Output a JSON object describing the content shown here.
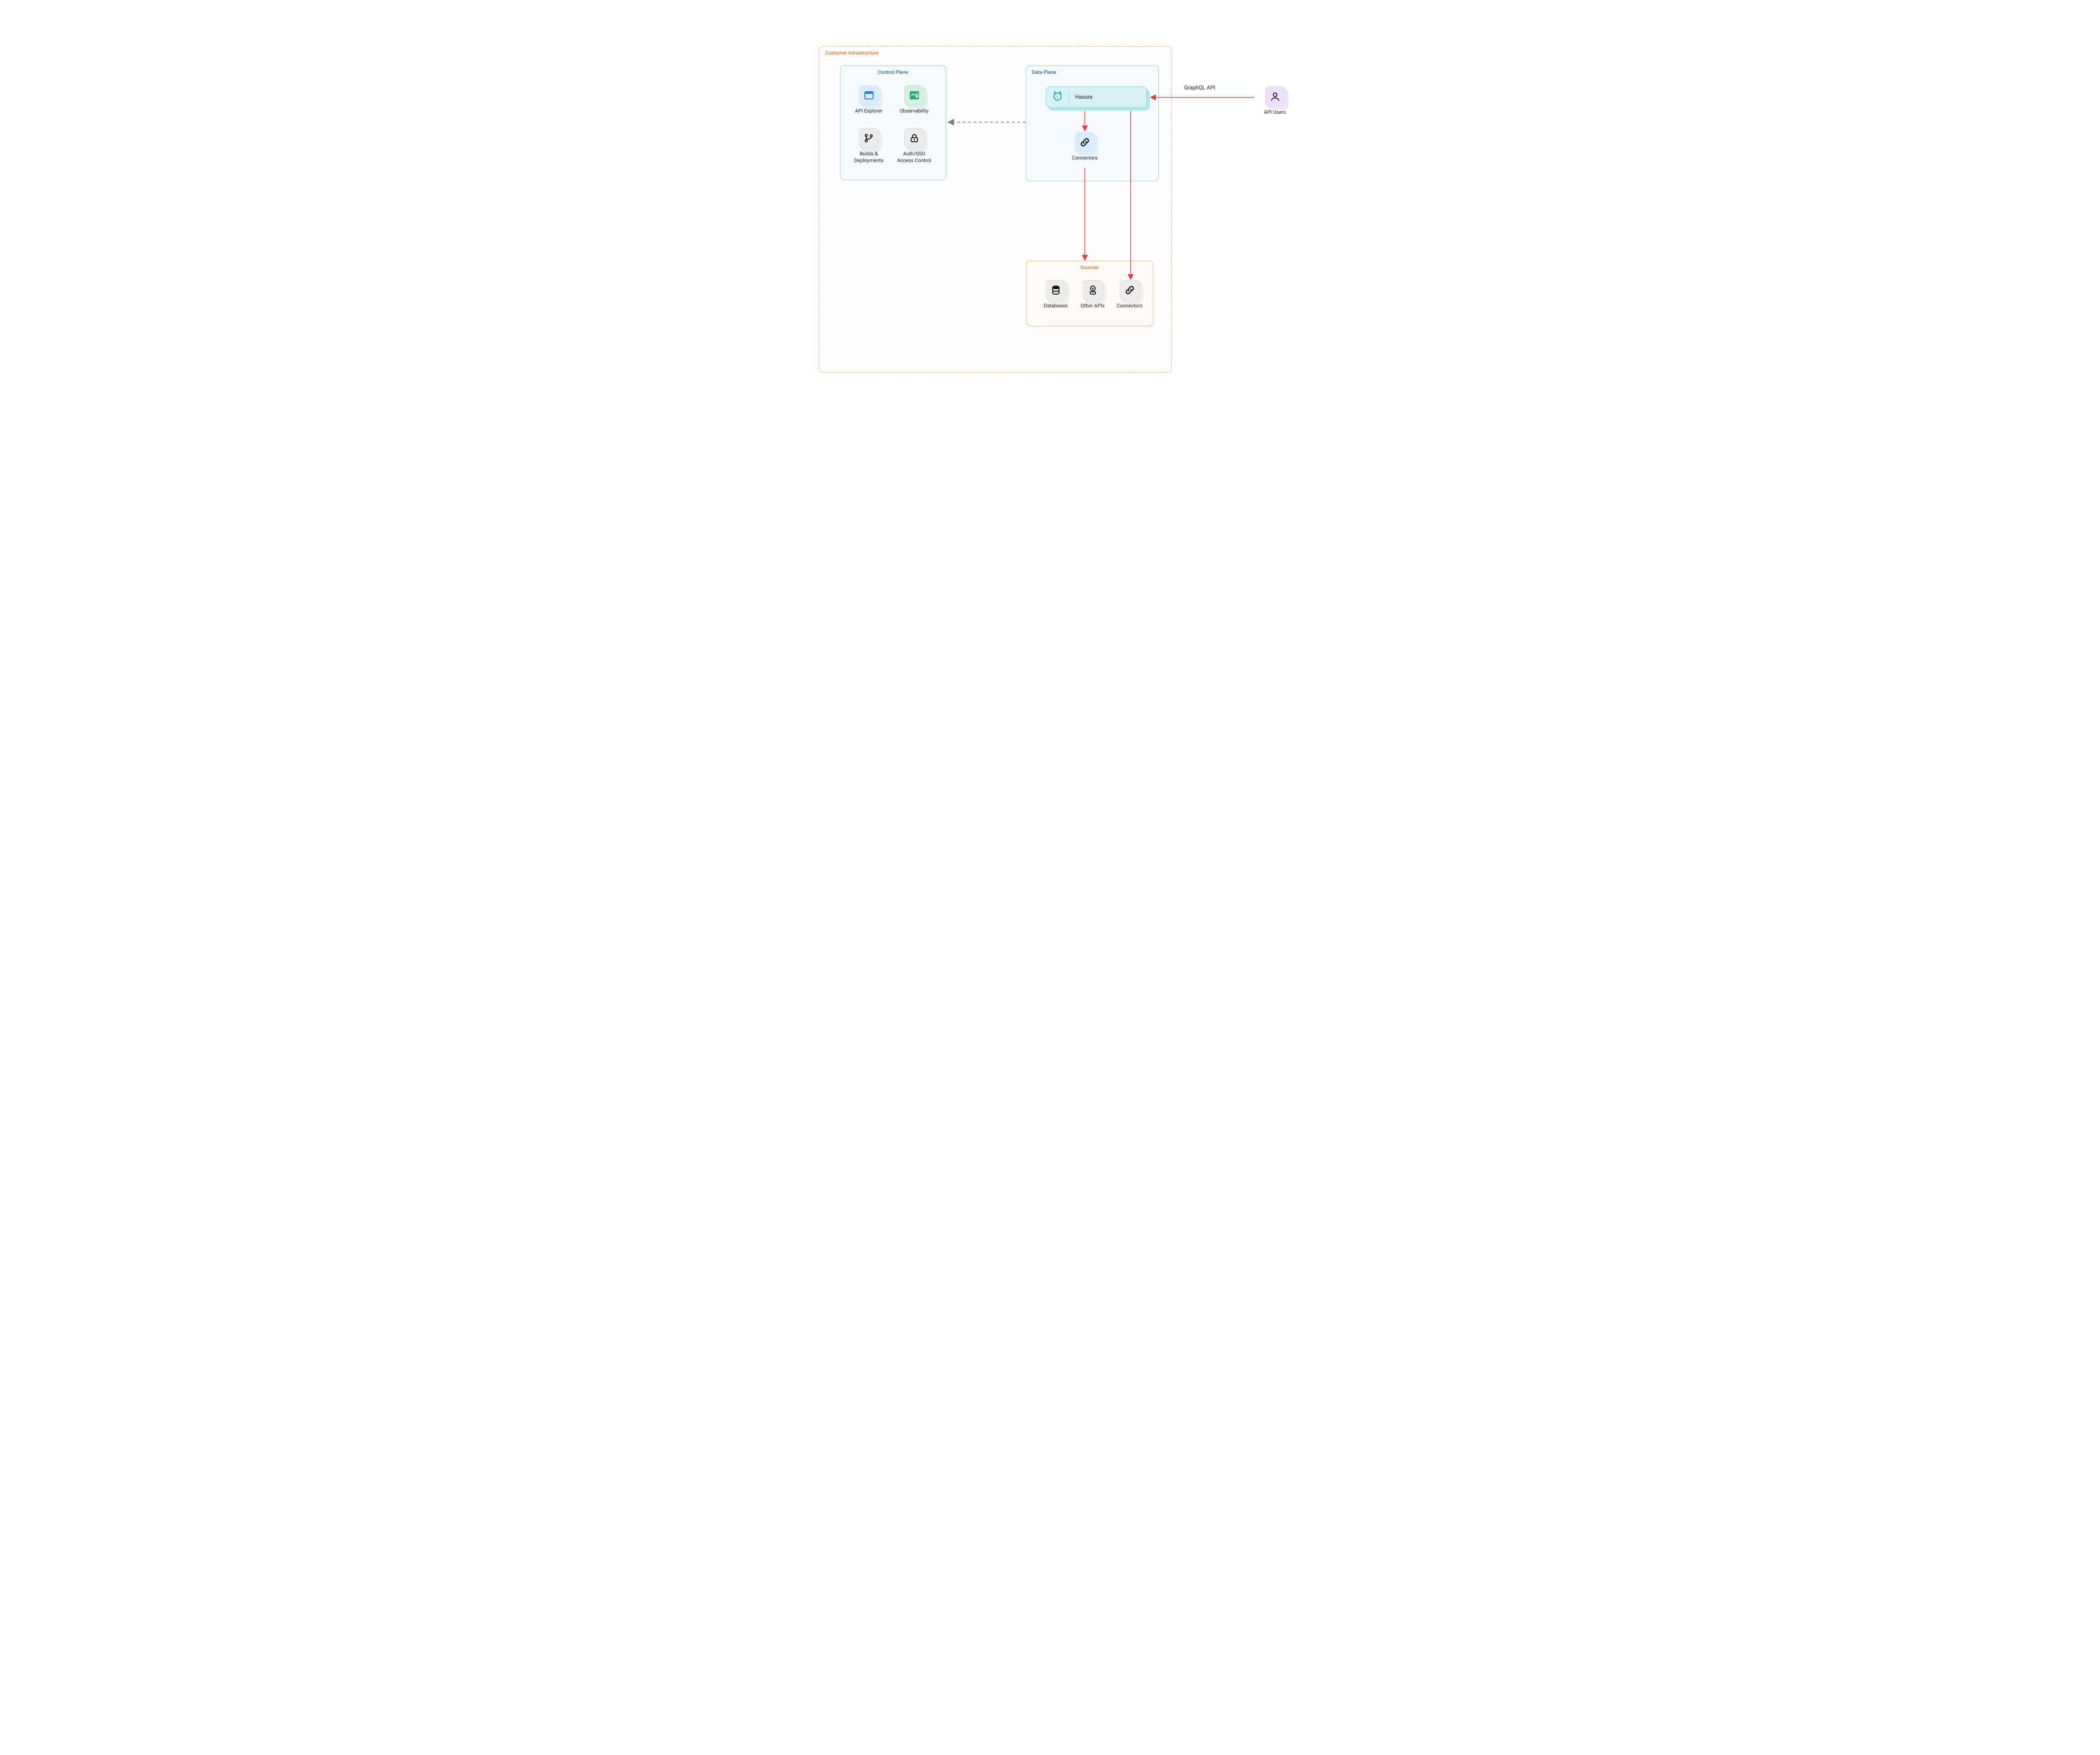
{
  "customer_pane": {
    "label": "Customer Infrastructure"
  },
  "control_plane": {
    "label": "Control Plane",
    "items": {
      "api_explorer": "API Explorer",
      "observability": "Observability",
      "builds": "Builds & Deployments",
      "auth": "Auth/SSO Access Control"
    }
  },
  "data_plane": {
    "label": "Data Plane",
    "hasura": "Hasura",
    "connectors": "Connectors"
  },
  "sources": {
    "label": "Sources",
    "databases": "Databases",
    "other_apis": "Other APIs",
    "connectors": "Connectors"
  },
  "api_users": {
    "label": "API Users"
  },
  "edge_label": "GraphQL API",
  "colors": {
    "arrow_red": "#e23b3b",
    "arrow_gray": "#808080",
    "customer_border": "#ef9854",
    "blue_border": "#8dc8ee",
    "orange_border": "#f3b080"
  }
}
